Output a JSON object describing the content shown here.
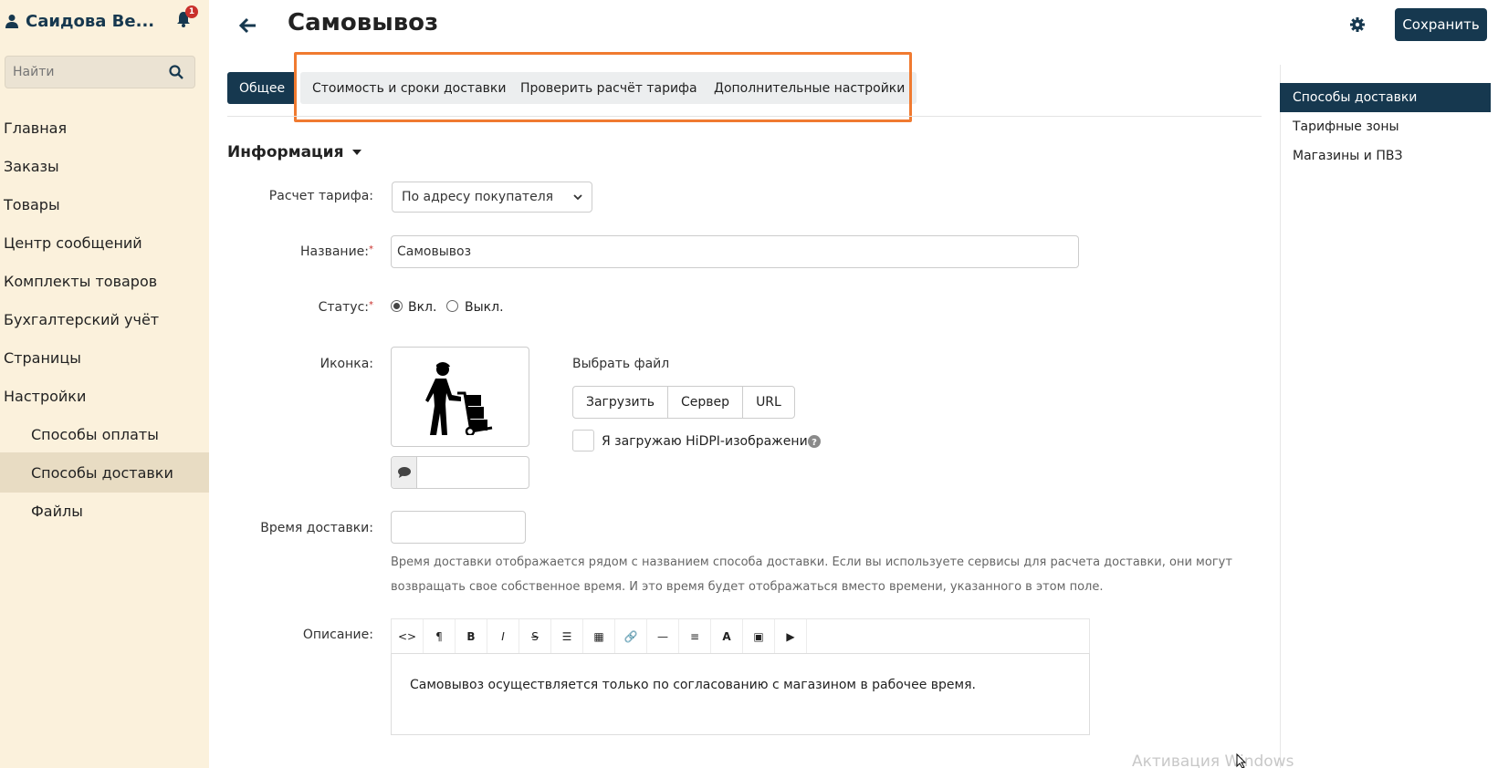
{
  "user": {
    "name": "Саидова Ве...",
    "notification_count": "1"
  },
  "search": {
    "placeholder": "Найти"
  },
  "nav": {
    "items": [
      {
        "label": "Главная"
      },
      {
        "label": "Заказы"
      },
      {
        "label": "Товары"
      },
      {
        "label": "Центр сообщений"
      },
      {
        "label": "Комплекты товаров"
      },
      {
        "label": "Бухгалтерский учёт"
      },
      {
        "label": "Страницы"
      },
      {
        "label": "Настройки"
      }
    ],
    "subitems": [
      {
        "label": "Способы оплаты"
      },
      {
        "label": "Способы доставки",
        "active": true
      },
      {
        "label": "Файлы"
      }
    ]
  },
  "header": {
    "title": "Самовывоз",
    "save_label": "Сохранить"
  },
  "tabs": [
    {
      "label": "Общее",
      "active": true
    },
    {
      "label": "Стоимость и сроки доставки"
    },
    {
      "label": "Проверить расчёт тарифа"
    },
    {
      "label": "Дополнительные настройки"
    }
  ],
  "right_panel": {
    "items": [
      {
        "label": "Способы доставки",
        "active": true
      },
      {
        "label": "Тарифные зоны"
      },
      {
        "label": "Магазины и ПВЗ"
      }
    ]
  },
  "form": {
    "section_title": "Информация",
    "tariff_label": "Расчет тарифа:",
    "tariff_value": "По адресу покупателя",
    "name_label": "Название:",
    "name_value": "Самовывоз",
    "status_label": "Статус:",
    "status_on": "Вкл.",
    "status_off": "Выкл.",
    "status_selected": "on",
    "icon_label": "Иконка:",
    "icon_name": "courier-with-hand-truck-icon",
    "choose_file_label": "Выбрать файл",
    "upload_buttons": [
      "Загрузить",
      "Сервер",
      "URL"
    ],
    "hidpi_label": "Я загружаю HiDPI-изображение.",
    "hidpi_checked": false,
    "delivery_time_label": "Время доставки:",
    "delivery_time_value": "",
    "delivery_time_hint": "Время доставки отображается рядом с названием способа доставки. Если вы используете сервисы для расчета доставки, они могут возвращать свое собственное время. И это время будет отображаться вместо времени, указанного в этом поле.",
    "description_label": "Описание:",
    "description_value": "Самовывоз осуществляется только по согласованию с магазином в рабочее время."
  },
  "editor_toolbar": [
    {
      "icon": "code-icon",
      "glyph": "<>"
    },
    {
      "icon": "paragraph-icon",
      "glyph": "¶"
    },
    {
      "icon": "bold-icon",
      "glyph": "B"
    },
    {
      "icon": "italic-icon",
      "glyph": "I"
    },
    {
      "icon": "strikethrough-icon",
      "glyph": "S"
    },
    {
      "icon": "list-icon",
      "glyph": "☰"
    },
    {
      "icon": "table-icon",
      "glyph": "▦"
    },
    {
      "icon": "link-icon",
      "glyph": "🔗"
    },
    {
      "icon": "horizontal-rule-icon",
      "glyph": "—"
    },
    {
      "icon": "align-icon",
      "glyph": "≡"
    },
    {
      "icon": "font-color-icon",
      "glyph": "A"
    },
    {
      "icon": "image-icon",
      "glyph": "▣"
    },
    {
      "icon": "video-icon",
      "glyph": "▶"
    }
  ],
  "watermark": "Активация Windows",
  "colors": {
    "accent": "#16384f",
    "sidebar_bg": "#fbf1dc",
    "highlight": "#f07a30",
    "required": "#c9302c"
  }
}
